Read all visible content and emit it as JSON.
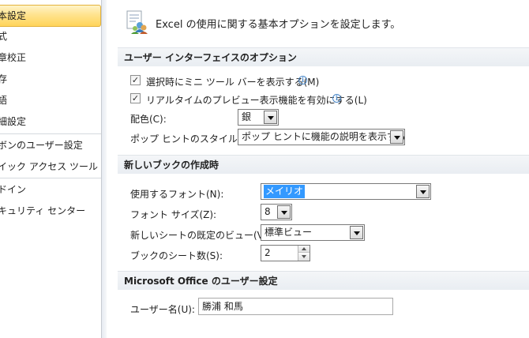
{
  "sidebar": {
    "items": [
      {
        "label": "本設定",
        "selected": true
      },
      {
        "label": "式"
      },
      {
        "label": "章校正"
      },
      {
        "label": "存"
      },
      {
        "label": "語"
      },
      {
        "label": "細設定"
      },
      {
        "label": "ボンのユーザー設定"
      },
      {
        "label": "イック アクセス ツール バー"
      },
      {
        "label": "ドイン"
      },
      {
        "label": "キュリティ センター"
      }
    ]
  },
  "header": {
    "text": "Excel の使用に関する基本オプションを設定します。",
    "icon": "options-icon"
  },
  "ui_section": {
    "title": "ユーザー インターフェイスのオプション",
    "mini_toolbar": {
      "label": "選択時にミニ ツール バーを表示する(M)",
      "checked": true
    },
    "live_preview": {
      "label": "リアルタイムのプレビュー表示機能を有効にする(L)",
      "checked": true
    },
    "color_scheme": {
      "label": "配色(C):",
      "value": "銀"
    },
    "screentip": {
      "label": "ポップ ヒントのスタイル(R):",
      "value": "ポップ ヒントに機能の説明を表示する"
    }
  },
  "new_book_section": {
    "title": "新しいブックの作成時",
    "font": {
      "label": "使用するフォント(N):",
      "value": "メイリオ"
    },
    "font_size": {
      "label": "フォント サイズ(Z):",
      "value": "8"
    },
    "default_view": {
      "label": "新しいシートの既定のビュー(V):",
      "value": "標準ビュー"
    },
    "sheet_count": {
      "label": "ブックのシート数(S):",
      "value": "2"
    }
  },
  "office_section": {
    "title": "Microsoft Office のユーザー設定",
    "user_name": {
      "label": "ユーザー名(U):",
      "value": "勝浦  和馬"
    }
  },
  "colors": {
    "selection_highlight": "#3399ff",
    "selected_nav": "#ffd45a",
    "info": "#4a88c9"
  }
}
